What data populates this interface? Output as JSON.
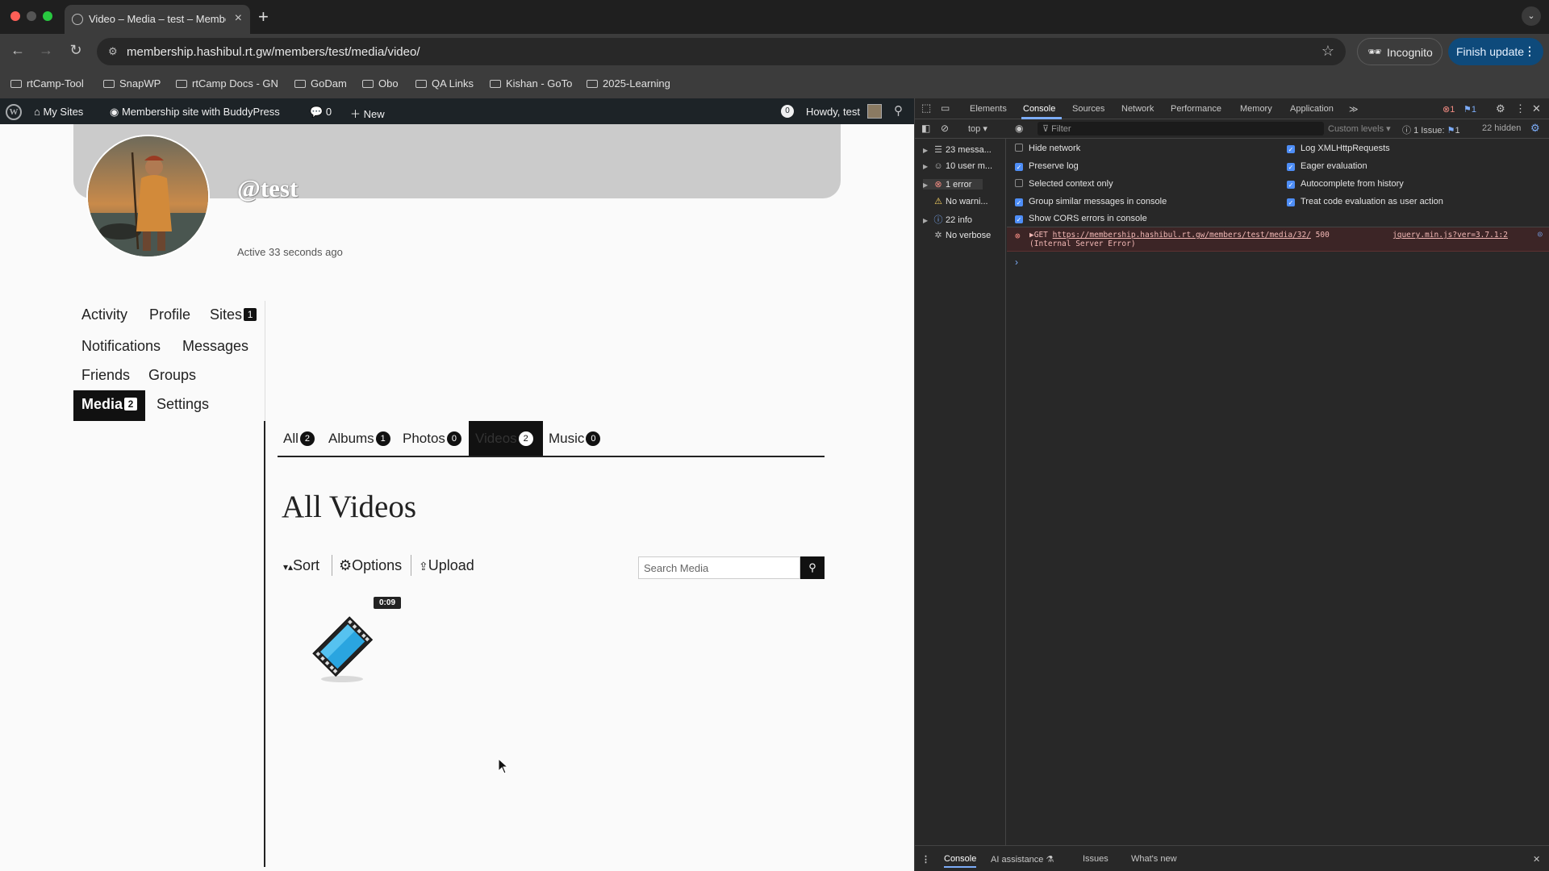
{
  "browser": {
    "tab_title": "Video – Media – test – Membership site with BuddyPress",
    "url": "membership.hashibul.rt.gw/members/test/media/video/",
    "incognito_label": "Incognito",
    "finish_update_label": "Finish update",
    "bookmarks": [
      "rtCamp-Tool",
      "SnapWP",
      "rtCamp Docs - GN",
      "GoDam",
      "Obo",
      "QA Links",
      "Kishan - GoTo",
      "2025-Learning"
    ]
  },
  "wpbar": {
    "my_sites": "My Sites",
    "site_name": "Membership site with BuddyPress",
    "comments_count": "0",
    "new_label": "New",
    "notif_count": "0",
    "howdy": "Howdy, test"
  },
  "profile": {
    "handle": "@test",
    "active": "Active 33 seconds ago",
    "nav": {
      "activity": "Activity",
      "profile": "Profile",
      "sites": "Sites",
      "sites_count": "1",
      "notifications": "Notifications",
      "messages": "Messages",
      "friends": "Friends",
      "groups": "Groups",
      "media": "Media",
      "media_count": "2",
      "settings": "Settings"
    }
  },
  "media": {
    "tabs": {
      "all": "All",
      "all_count": "2",
      "albums": "Albums",
      "albums_count": "1",
      "photos": "Photos",
      "photos_count": "0",
      "videos": "Videos",
      "videos_count": "2",
      "music": "Music",
      "music_count": "0"
    },
    "heading": "All Videos",
    "sort_label": "Sort",
    "options_label": "Options",
    "upload_label": "Upload",
    "search_placeholder": "Search Media",
    "video_duration": "0:09"
  },
  "devtools": {
    "tabs": [
      "Elements",
      "Console",
      "Sources",
      "Network",
      "Performance",
      "Memory",
      "Application"
    ],
    "error_badge": "1",
    "issue_badge": "1",
    "context": "top",
    "filter_placeholder": "Filter",
    "levels": "Custom levels",
    "issues_label": "1 Issue:",
    "issues_count": "1",
    "hidden": "22 hidden",
    "sidebar": [
      "23 messa...",
      "10 user m...",
      "1 error",
      "No warni...",
      "22 info",
      "No verbose"
    ],
    "options_left": [
      {
        "label": "Hide network",
        "checked": false
      },
      {
        "label": "Preserve log",
        "checked": true
      },
      {
        "label": "Selected context only",
        "checked": false
      },
      {
        "label": "Group similar messages in console",
        "checked": true
      },
      {
        "label": "Show CORS errors in console",
        "checked": true
      }
    ],
    "options_right": [
      {
        "label": "Log XMLHttpRequests",
        "checked": true
      },
      {
        "label": "Eager evaluation",
        "checked": true
      },
      {
        "label": "Autocomplete from history",
        "checked": true
      },
      {
        "label": "Treat code evaluation as user action",
        "checked": true
      }
    ],
    "error": {
      "method": "GET",
      "url": "https://membership.hashibul.rt.gw/members/test/media/32/",
      "status": "500",
      "status_text": "(Internal Server Error)",
      "source": "jquery.min.js?ver=3.7.1:2"
    },
    "bottom_tabs": [
      "Console",
      "AI assistance",
      "Issues",
      "What's new"
    ]
  },
  "colors": {
    "chrome_bg": "#3c3c3c",
    "wpbar_bg": "#1d2327",
    "accent_blue": "#0e4a7b",
    "error_bg": "#3c2526"
  }
}
